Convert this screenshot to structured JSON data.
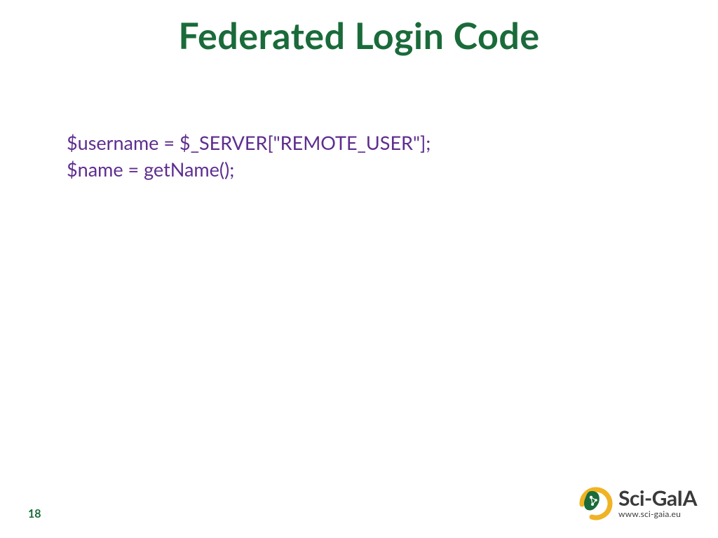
{
  "title": "Federated Login Code",
  "code": {
    "line1": "$username = $_SERVER[\"REMOTE_USER\"];",
    "line2": "$name = getName();"
  },
  "page_number": "18",
  "logo": {
    "brand": "Sci-GaIA",
    "url": "www.sci-gaia.eu"
  },
  "colors": {
    "title": "#1a6b3a",
    "code": "#5e2d8f",
    "logo_accent_yellow": "#f0b323",
    "logo_accent_green": "#1a6b3a"
  }
}
